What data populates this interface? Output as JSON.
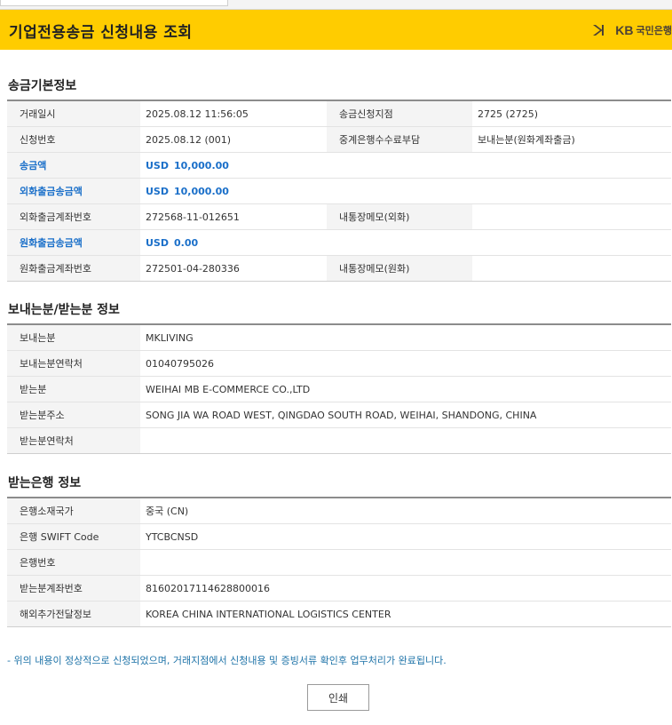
{
  "header": {
    "title": "기업전용송금 신청내용 조회",
    "logo_mark": "KB",
    "logo_kb": "KB",
    "logo_name": "국민은행",
    "brand_color": "#ffcc00"
  },
  "sections": {
    "basic": {
      "title": "송금기본정보",
      "rows": [
        {
          "label": "거래일시",
          "value": "2025.08.12 11:56:05",
          "label2": "송금신청지점",
          "value2": "2725 (2725)"
        },
        {
          "label": "신청번호",
          "value": "2025.08.12 (001)",
          "label2": "중계은행수수료부담",
          "value2": "보내는분(원화계좌출금)"
        },
        {
          "label": "송금액",
          "currency": "USD",
          "amount": "10,000.00"
        },
        {
          "label": "외화출금송금액",
          "currency": "USD",
          "amount": "10,000.00"
        },
        {
          "label": "외화출금계좌번호",
          "value": "272568-11-012651",
          "label2": "내통장메모(외화)",
          "value2": ""
        },
        {
          "label": "원화출금송금액",
          "currency": "USD",
          "amount": "0.00"
        },
        {
          "label": "원화출금계좌번호",
          "value": "272501-04-280336",
          "label2": "내통장메모(원화)",
          "value2": ""
        }
      ]
    },
    "parties": {
      "title": "보내는분/받는분 정보",
      "rows": [
        {
          "label": "보내는분",
          "value": "MKLIVING"
        },
        {
          "label": "보내는분연락처",
          "value": "01040795026"
        },
        {
          "label": "받는분",
          "value": "WEIHAI MB E-COMMERCE CO.,LTD"
        },
        {
          "label": "받는분주소",
          "value": "SONG JIA WA ROAD WEST, QINGDAO SOUTH ROAD, WEIHAI, SHANDONG, CHINA"
        },
        {
          "label": "받는분연락처",
          "value": ""
        }
      ]
    },
    "bank": {
      "title": "받는은행 정보",
      "rows": [
        {
          "label": "은행소재국가",
          "value": "중국 (CN)"
        },
        {
          "label": "은행 SWIFT Code",
          "value": "YTCBCNSD"
        },
        {
          "label": "은행번호",
          "value": ""
        },
        {
          "label": "받는분계좌번호",
          "value": "81602017114628800016"
        },
        {
          "label": "해외추가전달정보",
          "value": "KOREA CHINA INTERNATIONAL LOGISTICS CENTER"
        }
      ]
    }
  },
  "notice": "- 위의 내용이 정상적으로 신청되었으며, 거래지점에서 신청내용 및 증빙서류 확인후 업무처리가 완료됩니다.",
  "print_label": "인쇄",
  "colors": {
    "highlight_blue": "#1a6fc9",
    "notice_blue": "#1e73a8"
  }
}
